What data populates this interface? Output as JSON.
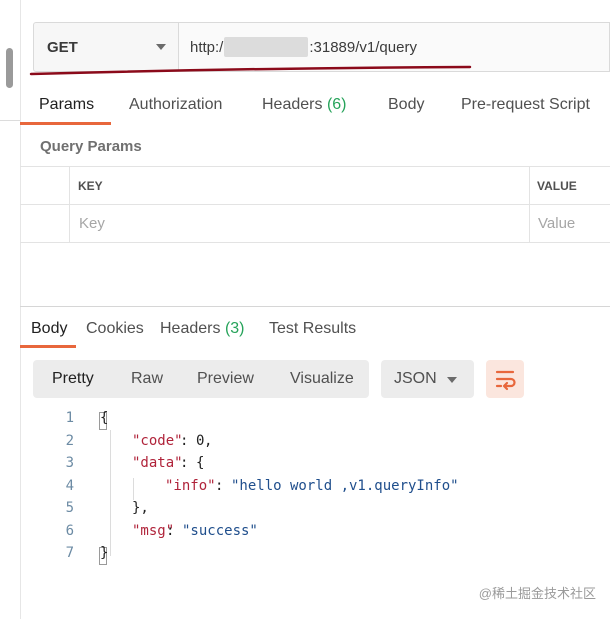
{
  "request": {
    "method": "GET",
    "url_prefix": "http:/",
    "url_suffix": ":31889/v1/query"
  },
  "request_tabs": [
    {
      "label": "Params",
      "count": ""
    },
    {
      "label": "Authorization",
      "count": ""
    },
    {
      "label": "Headers",
      "count": "(6)"
    },
    {
      "label": "Body",
      "count": ""
    },
    {
      "label": "Pre-request Script",
      "count": ""
    }
  ],
  "query_params": {
    "title": "Query Params",
    "col_key": "KEY",
    "col_value": "VALUE",
    "key_placeholder": "Key",
    "value_placeholder": "Value"
  },
  "response_tabs": [
    {
      "label": "Body",
      "count": ""
    },
    {
      "label": "Cookies",
      "count": ""
    },
    {
      "label": "Headers",
      "count": "(3)"
    },
    {
      "label": "Test Results",
      "count": ""
    }
  ],
  "view_modes": [
    "Pretty",
    "Raw",
    "Preview",
    "Visualize"
  ],
  "format": "JSON",
  "icons": {
    "method_dropdown": "chevron-down-icon",
    "format_dropdown": "chevron-down-icon",
    "wrap": "wrap-lines-icon"
  },
  "colors": {
    "accent": "#e8673c",
    "count_green": "#26a35a",
    "json_key": "#b0233a",
    "json_string": "#1f4e8c",
    "annotation_underline": "#8b0a1a"
  },
  "code": {
    "line_numbers": [
      "1",
      "2",
      "3",
      "4",
      "5",
      "6",
      "7"
    ],
    "open_brace": "{",
    "close_brace": "}",
    "code_key": "\"code\"",
    "code_value": "0",
    "data_key": "\"data\"",
    "info_key": "\"info\"",
    "info_value": "\"hello world ,v1.queryInfo\"",
    "msg_key": "\"msg\"",
    "msg_value": "\"success\"",
    "colon": ": ",
    "comma": ",",
    "inner_close": "},"
  },
  "watermark": "@稀土掘金技术社区"
}
